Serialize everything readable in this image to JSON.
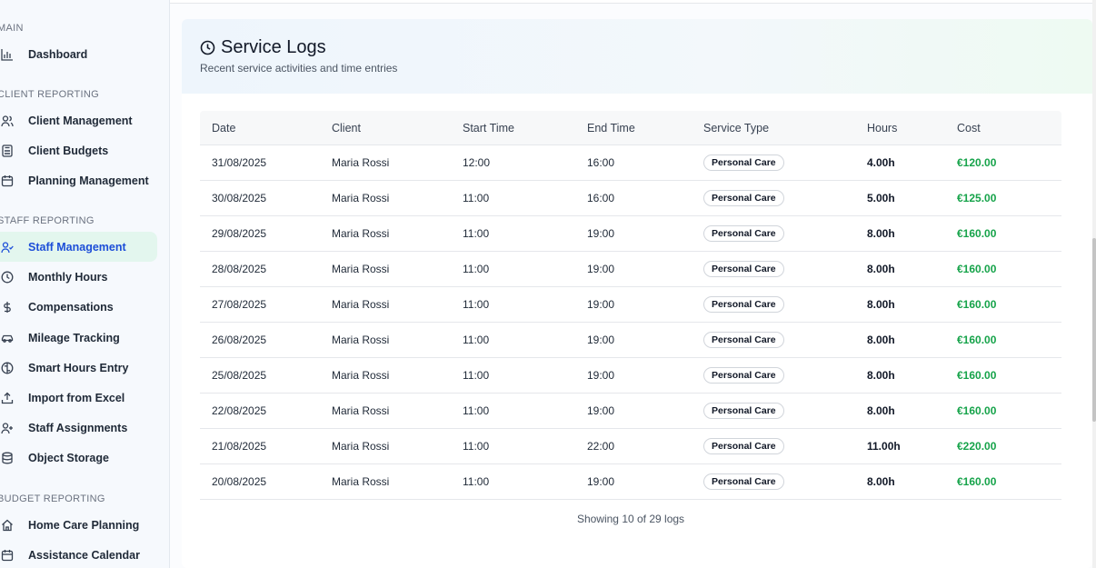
{
  "sidebar": {
    "sections": {
      "main": "MAIN",
      "client": "CLIENT REPORTING",
      "staff": "STAFF REPORTING",
      "budget": "BUDGET REPORTING"
    },
    "items": {
      "dashboard": "Dashboard",
      "client_management": "Client Management",
      "client_budgets": "Client Budgets",
      "planning_management": "Planning Management",
      "staff_management": "Staff Management",
      "monthly_hours": "Monthly Hours",
      "compensations": "Compensations",
      "mileage_tracking": "Mileage Tracking",
      "smart_hours_entry": "Smart Hours Entry",
      "import_excel": "Import from Excel",
      "staff_assignments": "Staff Assignments",
      "object_storage": "Object Storage",
      "home_care_planning": "Home Care Planning",
      "assistance_calendar": "Assistance Calendar"
    },
    "active": "staff_management"
  },
  "card": {
    "title": "Service Logs",
    "subtitle": "Recent service activities and time entries"
  },
  "table": {
    "headers": [
      "Date",
      "Client",
      "Start Time",
      "End Time",
      "Service Type",
      "Hours",
      "Cost"
    ],
    "rows": [
      [
        "31/08/2025",
        "Maria Rossi",
        "12:00",
        "16:00",
        "Personal Care",
        "4.00h",
        "€120.00"
      ],
      [
        "30/08/2025",
        "Maria Rossi",
        "11:00",
        "16:00",
        "Personal Care",
        "5.00h",
        "€125.00"
      ],
      [
        "29/08/2025",
        "Maria Rossi",
        "11:00",
        "19:00",
        "Personal Care",
        "8.00h",
        "€160.00"
      ],
      [
        "28/08/2025",
        "Maria Rossi",
        "11:00",
        "19:00",
        "Personal Care",
        "8.00h",
        "€160.00"
      ],
      [
        "27/08/2025",
        "Maria Rossi",
        "11:00",
        "19:00",
        "Personal Care",
        "8.00h",
        "€160.00"
      ],
      [
        "26/08/2025",
        "Maria Rossi",
        "11:00",
        "19:00",
        "Personal Care",
        "8.00h",
        "€160.00"
      ],
      [
        "25/08/2025",
        "Maria Rossi",
        "11:00",
        "19:00",
        "Personal Care",
        "8.00h",
        "€160.00"
      ],
      [
        "22/08/2025",
        "Maria Rossi",
        "11:00",
        "19:00",
        "Personal Care",
        "8.00h",
        "€160.00"
      ],
      [
        "21/08/2025",
        "Maria Rossi",
        "11:00",
        "22:00",
        "Personal Care",
        "11.00h",
        "€220.00"
      ],
      [
        "20/08/2025",
        "Maria Rossi",
        "11:00",
        "19:00",
        "Personal Care",
        "8.00h",
        "€160.00"
      ]
    ],
    "footer": "Showing 10 of 29 logs"
  },
  "colors": {
    "accent": "#1d4ed8",
    "active_bg": "#e3f6ee",
    "cost_green": "#16a34a"
  }
}
